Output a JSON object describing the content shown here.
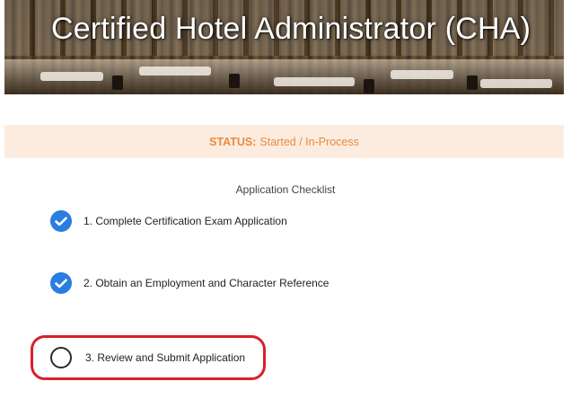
{
  "header": {
    "title": "Certified Hotel Administrator (CHA)"
  },
  "status": {
    "label": "STATUS:",
    "value": "Started / In-Process"
  },
  "checklist": {
    "title": "Application Checklist",
    "items": [
      {
        "label": "1. Complete Certification Exam Application",
        "completed": true,
        "icon": "check-circle-icon"
      },
      {
        "label": "2. Obtain an Employment and Character Reference",
        "completed": true,
        "icon": "check-circle-icon"
      },
      {
        "label": "3. Review and Submit Application",
        "completed": false,
        "icon": "empty-circle-icon"
      }
    ]
  },
  "colors": {
    "accent_blue": "#2a7de1",
    "status_orange": "#ec8a3c",
    "status_background": "#fcece0",
    "highlight_red": "#d9202b"
  }
}
